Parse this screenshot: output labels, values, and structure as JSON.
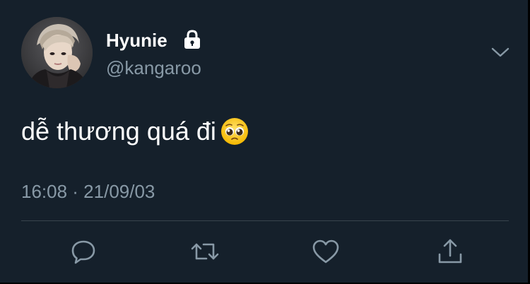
{
  "user": {
    "display_name": "Hyunie",
    "handle": "@kangaroo",
    "protected_icon": "lock-icon",
    "avatar_icon": "profile-photo"
  },
  "tweet": {
    "text": "dễ thương quá đi",
    "emoji": "pleading-face-emoji",
    "timestamp": "16:08 · 21/09/03"
  },
  "actions": [
    {
      "name": "reply",
      "icon": "speech-bubble-icon"
    },
    {
      "name": "retweet",
      "icon": "retweet-arrows-icon"
    },
    {
      "name": "like",
      "icon": "heart-icon"
    },
    {
      "name": "share",
      "icon": "share-arrow-icon"
    }
  ],
  "menu_icon": "chevron-down-icon",
  "colors": {
    "background": "#15202b",
    "primary_text": "#ffffff",
    "secondary_text": "#8899a6",
    "divider": "#38444d"
  }
}
